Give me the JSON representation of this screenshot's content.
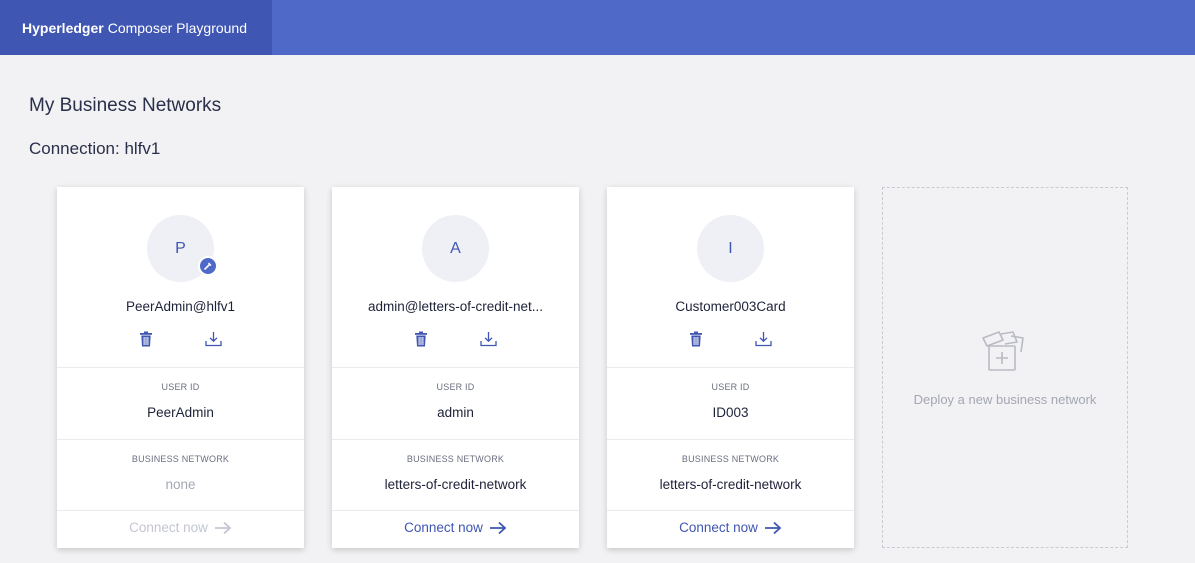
{
  "header": {
    "brand_bold": "Hyperledger",
    "brand_rest": "Composer Playground"
  },
  "page": {
    "title": "My Business Networks",
    "connection": "Connection: hlfv1"
  },
  "labels": {
    "user_id": "USER ID",
    "business_network": "BUSINESS NETWORK"
  },
  "cards": [
    {
      "initial": "P",
      "name": "PeerAdmin@hlfv1",
      "user_id": "PeerAdmin",
      "business_network": "none",
      "connect_label": "Connect now",
      "connect_enabled": false,
      "has_admin_badge": true
    },
    {
      "initial": "A",
      "name": "admin@letters-of-credit-net...",
      "user_id": "admin",
      "business_network": "letters-of-credit-network",
      "connect_label": "Connect now",
      "connect_enabled": true,
      "has_admin_badge": false
    },
    {
      "initial": "I",
      "name": "Customer003Card",
      "user_id": "ID003",
      "business_network": "letters-of-credit-network",
      "connect_label": "Connect now",
      "connect_enabled": true,
      "has_admin_badge": false
    }
  ],
  "deploy": {
    "label": "Deploy a new business network"
  },
  "colors": {
    "header": "#4e69c8",
    "brand_bg": "#3f56b2",
    "accent": "#3f56b2",
    "disabled": "#c3c6d2"
  },
  "icons": {
    "delete": "trash-icon",
    "export": "download-icon",
    "connect": "arrow-right-icon",
    "admin_badge": "hammer-icon",
    "deploy": "deploy-network-icon"
  }
}
